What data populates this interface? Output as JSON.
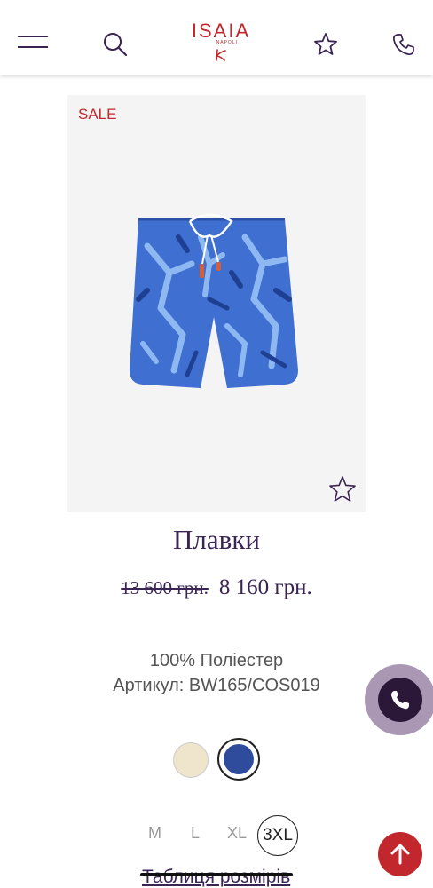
{
  "header": {
    "brand": "ISAIA",
    "brand_sub": "NAPOLI"
  },
  "product": {
    "badge": "SALE",
    "title": "Плавки",
    "old_price": "13 600 грн.",
    "new_price": "8 160 грн.",
    "material": "100% Поліестер",
    "sku": "Артикул: BW165/COS019",
    "colors": [
      "#efe4cc",
      "#2f4b9c"
    ],
    "selected_color": "#2f4b9c",
    "sizes": [
      "M",
      "L",
      "XL",
      "3XL"
    ],
    "selected_size": "3XL",
    "size_chart_label": "Таблиця розмірів"
  },
  "colors": {
    "accent_red": "#c1272d",
    "brand_purple": "#3a2454"
  },
  "icons": [
    "menu-icon",
    "search-icon",
    "star-icon",
    "phone-icon",
    "arrow-up-icon"
  ]
}
